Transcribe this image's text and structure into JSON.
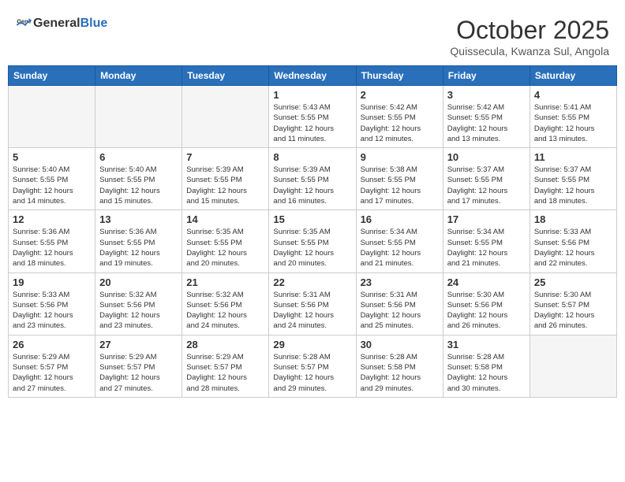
{
  "header": {
    "logo_general": "General",
    "logo_blue": "Blue",
    "month": "October 2025",
    "location": "Quissecula, Kwanza Sul, Angola"
  },
  "days_of_week": [
    "Sunday",
    "Monday",
    "Tuesday",
    "Wednesday",
    "Thursday",
    "Friday",
    "Saturday"
  ],
  "weeks": [
    [
      {
        "day": "",
        "info": ""
      },
      {
        "day": "",
        "info": ""
      },
      {
        "day": "",
        "info": ""
      },
      {
        "day": "1",
        "info": "Sunrise: 5:43 AM\nSunset: 5:55 PM\nDaylight: 12 hours\nand 11 minutes."
      },
      {
        "day": "2",
        "info": "Sunrise: 5:42 AM\nSunset: 5:55 PM\nDaylight: 12 hours\nand 12 minutes."
      },
      {
        "day": "3",
        "info": "Sunrise: 5:42 AM\nSunset: 5:55 PM\nDaylight: 12 hours\nand 13 minutes."
      },
      {
        "day": "4",
        "info": "Sunrise: 5:41 AM\nSunset: 5:55 PM\nDaylight: 12 hours\nand 13 minutes."
      }
    ],
    [
      {
        "day": "5",
        "info": "Sunrise: 5:40 AM\nSunset: 5:55 PM\nDaylight: 12 hours\nand 14 minutes."
      },
      {
        "day": "6",
        "info": "Sunrise: 5:40 AM\nSunset: 5:55 PM\nDaylight: 12 hours\nand 15 minutes."
      },
      {
        "day": "7",
        "info": "Sunrise: 5:39 AM\nSunset: 5:55 PM\nDaylight: 12 hours\nand 15 minutes."
      },
      {
        "day": "8",
        "info": "Sunrise: 5:39 AM\nSunset: 5:55 PM\nDaylight: 12 hours\nand 16 minutes."
      },
      {
        "day": "9",
        "info": "Sunrise: 5:38 AM\nSunset: 5:55 PM\nDaylight: 12 hours\nand 17 minutes."
      },
      {
        "day": "10",
        "info": "Sunrise: 5:37 AM\nSunset: 5:55 PM\nDaylight: 12 hours\nand 17 minutes."
      },
      {
        "day": "11",
        "info": "Sunrise: 5:37 AM\nSunset: 5:55 PM\nDaylight: 12 hours\nand 18 minutes."
      }
    ],
    [
      {
        "day": "12",
        "info": "Sunrise: 5:36 AM\nSunset: 5:55 PM\nDaylight: 12 hours\nand 18 minutes."
      },
      {
        "day": "13",
        "info": "Sunrise: 5:36 AM\nSunset: 5:55 PM\nDaylight: 12 hours\nand 19 minutes."
      },
      {
        "day": "14",
        "info": "Sunrise: 5:35 AM\nSunset: 5:55 PM\nDaylight: 12 hours\nand 20 minutes."
      },
      {
        "day": "15",
        "info": "Sunrise: 5:35 AM\nSunset: 5:55 PM\nDaylight: 12 hours\nand 20 minutes."
      },
      {
        "day": "16",
        "info": "Sunrise: 5:34 AM\nSunset: 5:55 PM\nDaylight: 12 hours\nand 21 minutes."
      },
      {
        "day": "17",
        "info": "Sunrise: 5:34 AM\nSunset: 5:55 PM\nDaylight: 12 hours\nand 21 minutes."
      },
      {
        "day": "18",
        "info": "Sunrise: 5:33 AM\nSunset: 5:56 PM\nDaylight: 12 hours\nand 22 minutes."
      }
    ],
    [
      {
        "day": "19",
        "info": "Sunrise: 5:33 AM\nSunset: 5:56 PM\nDaylight: 12 hours\nand 23 minutes."
      },
      {
        "day": "20",
        "info": "Sunrise: 5:32 AM\nSunset: 5:56 PM\nDaylight: 12 hours\nand 23 minutes."
      },
      {
        "day": "21",
        "info": "Sunrise: 5:32 AM\nSunset: 5:56 PM\nDaylight: 12 hours\nand 24 minutes."
      },
      {
        "day": "22",
        "info": "Sunrise: 5:31 AM\nSunset: 5:56 PM\nDaylight: 12 hours\nand 24 minutes."
      },
      {
        "day": "23",
        "info": "Sunrise: 5:31 AM\nSunset: 5:56 PM\nDaylight: 12 hours\nand 25 minutes."
      },
      {
        "day": "24",
        "info": "Sunrise: 5:30 AM\nSunset: 5:56 PM\nDaylight: 12 hours\nand 26 minutes."
      },
      {
        "day": "25",
        "info": "Sunrise: 5:30 AM\nSunset: 5:57 PM\nDaylight: 12 hours\nand 26 minutes."
      }
    ],
    [
      {
        "day": "26",
        "info": "Sunrise: 5:29 AM\nSunset: 5:57 PM\nDaylight: 12 hours\nand 27 minutes."
      },
      {
        "day": "27",
        "info": "Sunrise: 5:29 AM\nSunset: 5:57 PM\nDaylight: 12 hours\nand 27 minutes."
      },
      {
        "day": "28",
        "info": "Sunrise: 5:29 AM\nSunset: 5:57 PM\nDaylight: 12 hours\nand 28 minutes."
      },
      {
        "day": "29",
        "info": "Sunrise: 5:28 AM\nSunset: 5:57 PM\nDaylight: 12 hours\nand 29 minutes."
      },
      {
        "day": "30",
        "info": "Sunrise: 5:28 AM\nSunset: 5:58 PM\nDaylight: 12 hours\nand 29 minutes."
      },
      {
        "day": "31",
        "info": "Sunrise: 5:28 AM\nSunset: 5:58 PM\nDaylight: 12 hours\nand 30 minutes."
      },
      {
        "day": "",
        "info": ""
      }
    ]
  ]
}
